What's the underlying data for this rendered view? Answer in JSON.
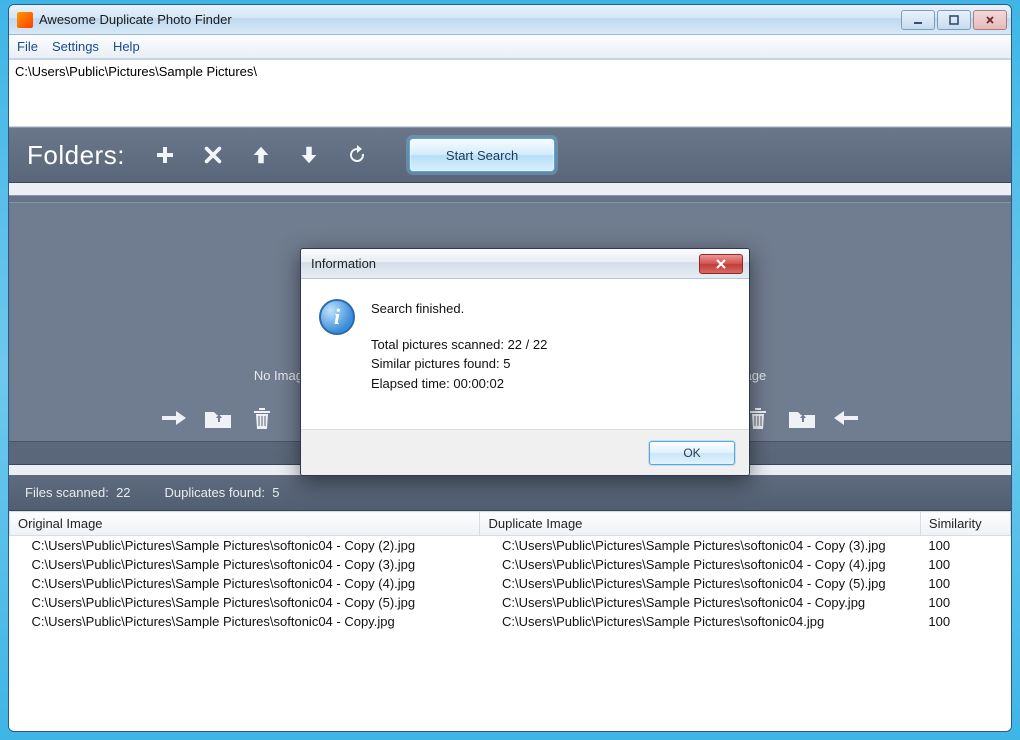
{
  "window": {
    "title": "Awesome Duplicate Photo Finder"
  },
  "menu": {
    "file": "File",
    "settings": "Settings",
    "help": "Help"
  },
  "path": "C:\\Users\\Public\\Pictures\\Sample Pictures\\",
  "toolbar": {
    "label": "Folders:",
    "start": "Start Search"
  },
  "preview": {
    "noimage_left": "No Image",
    "noimage_right": "No Image"
  },
  "status": {
    "scanned_label": "Files scanned:",
    "scanned_value": "22",
    "dup_label": "Duplicates found:",
    "dup_value": "5"
  },
  "table": {
    "headers": {
      "orig": "Original Image",
      "dup": "Duplicate Image",
      "sim": "Similarity"
    },
    "rows": [
      {
        "orig": "C:\\Users\\Public\\Pictures\\Sample Pictures\\softonic04 - Copy (2).jpg",
        "dup": "C:\\Users\\Public\\Pictures\\Sample Pictures\\softonic04 - Copy (3).jpg",
        "sim": "100"
      },
      {
        "orig": "C:\\Users\\Public\\Pictures\\Sample Pictures\\softonic04 - Copy (3).jpg",
        "dup": "C:\\Users\\Public\\Pictures\\Sample Pictures\\softonic04 - Copy (4).jpg",
        "sim": "100"
      },
      {
        "orig": "C:\\Users\\Public\\Pictures\\Sample Pictures\\softonic04 - Copy (4).jpg",
        "dup": "C:\\Users\\Public\\Pictures\\Sample Pictures\\softonic04 - Copy (5).jpg",
        "sim": "100"
      },
      {
        "orig": "C:\\Users\\Public\\Pictures\\Sample Pictures\\softonic04 - Copy (5).jpg",
        "dup": "C:\\Users\\Public\\Pictures\\Sample Pictures\\softonic04 - Copy.jpg",
        "sim": "100"
      },
      {
        "orig": "C:\\Users\\Public\\Pictures\\Sample Pictures\\softonic04 - Copy.jpg",
        "dup": "C:\\Users\\Public\\Pictures\\Sample Pictures\\softonic04.jpg",
        "sim": "100"
      }
    ]
  },
  "dialog": {
    "title": "Information",
    "line1": "Search finished.",
    "line2": "Total pictures scanned: 22 / 22",
    "line3": "Similar pictures found: 5",
    "line4": "Elapsed time: 00:00:02",
    "ok": "OK"
  }
}
